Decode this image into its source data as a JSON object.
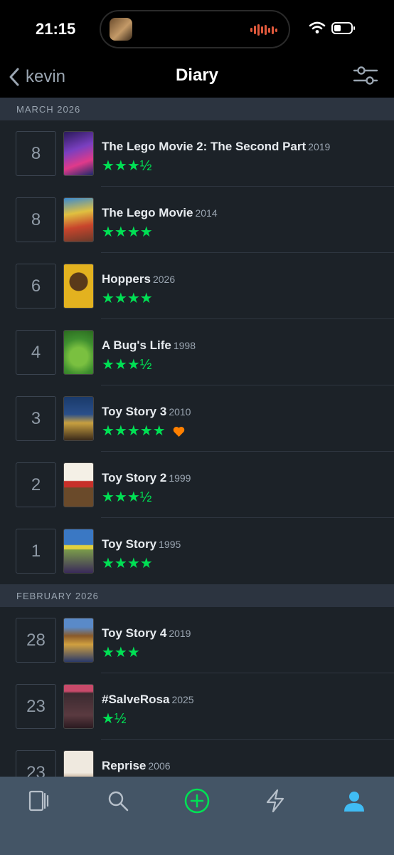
{
  "status_bar": {
    "time": "21:15"
  },
  "nav": {
    "back_label": "kevin",
    "title": "Diary"
  },
  "diary": {
    "months": [
      {
        "label": "MARCH 2026",
        "entries": [
          {
            "day": "8",
            "title": "The Lego Movie 2: The Second Part",
            "year": "2019",
            "stars": "★★★½",
            "liked": false
          },
          {
            "day": "8",
            "title": "The Lego Movie",
            "year": "2014",
            "stars": "★★★★",
            "liked": false
          },
          {
            "day": "6",
            "title": "Hoppers",
            "year": "2026",
            "stars": "★★★★",
            "liked": false
          },
          {
            "day": "4",
            "title": "A Bug's Life",
            "year": "1998",
            "stars": "★★★½",
            "liked": false
          },
          {
            "day": "3",
            "title": "Toy Story 3",
            "year": "2010",
            "stars": "★★★★★",
            "liked": true
          },
          {
            "day": "2",
            "title": "Toy Story 2",
            "year": "1999",
            "stars": "★★★½",
            "liked": false
          },
          {
            "day": "1",
            "title": "Toy Story",
            "year": "1995",
            "stars": "★★★★",
            "liked": false
          }
        ]
      },
      {
        "label": "FEBRUARY 2026",
        "entries": [
          {
            "day": "28",
            "title": "Toy Story 4",
            "year": "2019",
            "stars": "★★★",
            "liked": false
          },
          {
            "day": "23",
            "title": "#SalveRosa",
            "year": "2025",
            "stars": "★½",
            "liked": false
          },
          {
            "day": "23",
            "title": "Reprise",
            "year": "2006",
            "stars": "",
            "liked": false
          }
        ]
      }
    ]
  },
  "posters": {
    "lego2": "#4a2a7a",
    "lego": "#c8452c",
    "hoppers": "#e3b21f",
    "bugs": "#3f8f2f",
    "ts3": "#2a4f8a",
    "ts2": "#e8e3d6",
    "ts1": "#3a78c4",
    "ts4": "#8a5a2a",
    "salverosa": "#3b2a30",
    "reprise": "#efe9df"
  },
  "colors": {
    "accent_green": "#00e054",
    "heart_orange": "#ff8000",
    "active_tab_blue": "#40bcf4"
  },
  "tab_bar": {
    "items": [
      "films-icon",
      "search-icon",
      "add-icon",
      "activity-icon",
      "profile-icon"
    ],
    "active": "profile-icon"
  }
}
